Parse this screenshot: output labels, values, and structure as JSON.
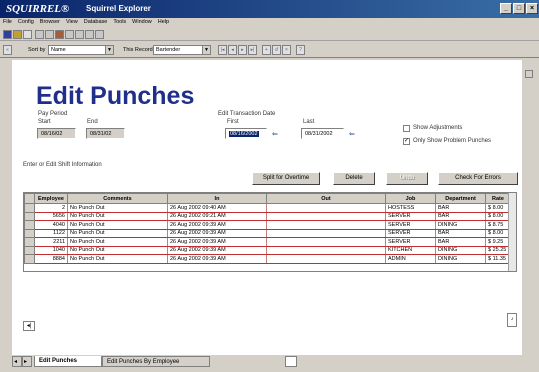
{
  "window": {
    "app_logo": "SQUIRREL®",
    "app_title": "Squirrel Explorer",
    "min": "_",
    "max": "□",
    "close": "×"
  },
  "menu": [
    "File",
    "Config",
    "Browser",
    "View",
    "Database",
    "Tools",
    "Window",
    "Help"
  ],
  "toolbar": {
    "sort_label": "Sort by",
    "sort_value": "Name",
    "this_record_label": "This Record",
    "this_record_value": "Bartender"
  },
  "page": {
    "title": "Edit Punches"
  },
  "pay_period": {
    "label": "Pay Period",
    "start_label": "Start",
    "start_value": "08/16/02",
    "end_label": "End",
    "end_value": "08/31/02"
  },
  "edit_date": {
    "label": "Edit Transaction Date",
    "first_label": "First",
    "first_value": "08/16/2002",
    "last_label": "Last",
    "last_value": "08/31/2002"
  },
  "options": {
    "show_adjustments": "Show Adjustments",
    "show_adjustments_checked": false,
    "only_problem": "Only Show Problem Punches",
    "only_problem_checked": true
  },
  "shift": {
    "label": "Enter or Edit Shift Information"
  },
  "buttons": {
    "split": "Split for Overtime",
    "delete": "Delete",
    "disabled": "Undo",
    "check": "Check For Errors"
  },
  "grid": {
    "columns": [
      "Employee",
      "Comments",
      "In",
      "Out",
      "Job",
      "Department",
      "Rate"
    ],
    "rows": [
      [
        "2",
        "No Punch Out",
        "26 Aug 2002  09:40 AM",
        "",
        "HOSTESS",
        "BAR",
        "$   8.00"
      ],
      [
        "5656",
        "No Punch Out",
        "26 Aug 2002  09:21 AM",
        "",
        "SERVER",
        "BAR",
        "$   8.00"
      ],
      [
        "4040",
        "No Punch Out",
        "26 Aug 2002  09:39 AM",
        "",
        "SERVER",
        "DINING",
        "$   8.75"
      ],
      [
        "1122",
        "No Punch Out",
        "26 Aug 2002  09:39 AM",
        "",
        "SERVER",
        "BAR",
        "$   8.00"
      ],
      [
        "2211",
        "No Punch Out",
        "26 Aug 2002  09:39 AM",
        "",
        "SERVER",
        "BAR",
        "$   9.25"
      ],
      [
        "1040",
        "No Punch Out",
        "26 Aug 2002  09:39 AM",
        "",
        "KITCHEN",
        "DINING",
        "$ 25.25"
      ],
      [
        "8884",
        "No Punch Out",
        "26 Aug 2002  09:39 AM",
        "",
        "ADMIN",
        "DINING",
        "$ 11.35"
      ]
    ]
  },
  "tabs": [
    "Edit Punches",
    "Edit Punches By Employee"
  ]
}
